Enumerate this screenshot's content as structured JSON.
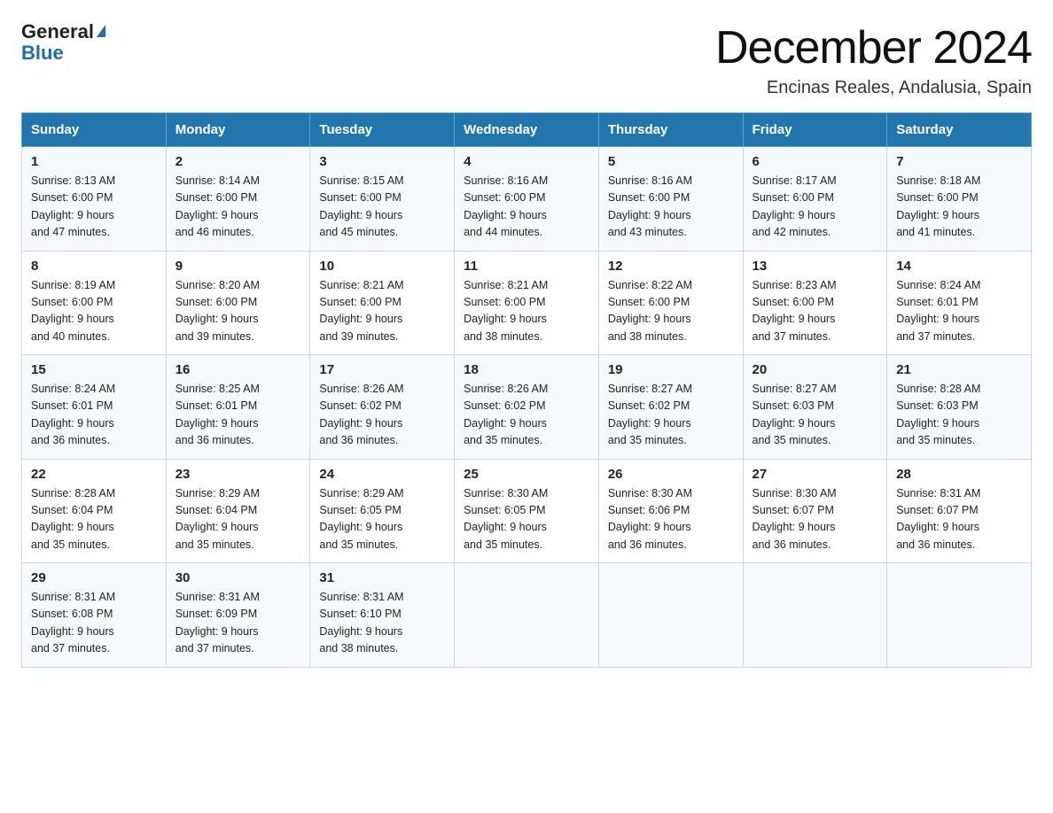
{
  "header": {
    "logo_general": "General",
    "logo_blue": "Blue",
    "main_title": "December 2024",
    "subtitle": "Encinas Reales, Andalusia, Spain"
  },
  "weekdays": [
    "Sunday",
    "Monday",
    "Tuesday",
    "Wednesday",
    "Thursday",
    "Friday",
    "Saturday"
  ],
  "weeks": [
    [
      {
        "day": "1",
        "sunrise": "8:13 AM",
        "sunset": "6:00 PM",
        "daylight": "9 hours and 47 minutes."
      },
      {
        "day": "2",
        "sunrise": "8:14 AM",
        "sunset": "6:00 PM",
        "daylight": "9 hours and 46 minutes."
      },
      {
        "day": "3",
        "sunrise": "8:15 AM",
        "sunset": "6:00 PM",
        "daylight": "9 hours and 45 minutes."
      },
      {
        "day": "4",
        "sunrise": "8:16 AM",
        "sunset": "6:00 PM",
        "daylight": "9 hours and 44 minutes."
      },
      {
        "day": "5",
        "sunrise": "8:16 AM",
        "sunset": "6:00 PM",
        "daylight": "9 hours and 43 minutes."
      },
      {
        "day": "6",
        "sunrise": "8:17 AM",
        "sunset": "6:00 PM",
        "daylight": "9 hours and 42 minutes."
      },
      {
        "day": "7",
        "sunrise": "8:18 AM",
        "sunset": "6:00 PM",
        "daylight": "9 hours and 41 minutes."
      }
    ],
    [
      {
        "day": "8",
        "sunrise": "8:19 AM",
        "sunset": "6:00 PM",
        "daylight": "9 hours and 40 minutes."
      },
      {
        "day": "9",
        "sunrise": "8:20 AM",
        "sunset": "6:00 PM",
        "daylight": "9 hours and 39 minutes."
      },
      {
        "day": "10",
        "sunrise": "8:21 AM",
        "sunset": "6:00 PM",
        "daylight": "9 hours and 39 minutes."
      },
      {
        "day": "11",
        "sunrise": "8:21 AM",
        "sunset": "6:00 PM",
        "daylight": "9 hours and 38 minutes."
      },
      {
        "day": "12",
        "sunrise": "8:22 AM",
        "sunset": "6:00 PM",
        "daylight": "9 hours and 38 minutes."
      },
      {
        "day": "13",
        "sunrise": "8:23 AM",
        "sunset": "6:00 PM",
        "daylight": "9 hours and 37 minutes."
      },
      {
        "day": "14",
        "sunrise": "8:24 AM",
        "sunset": "6:01 PM",
        "daylight": "9 hours and 37 minutes."
      }
    ],
    [
      {
        "day": "15",
        "sunrise": "8:24 AM",
        "sunset": "6:01 PM",
        "daylight": "9 hours and 36 minutes."
      },
      {
        "day": "16",
        "sunrise": "8:25 AM",
        "sunset": "6:01 PM",
        "daylight": "9 hours and 36 minutes."
      },
      {
        "day": "17",
        "sunrise": "8:26 AM",
        "sunset": "6:02 PM",
        "daylight": "9 hours and 36 minutes."
      },
      {
        "day": "18",
        "sunrise": "8:26 AM",
        "sunset": "6:02 PM",
        "daylight": "9 hours and 35 minutes."
      },
      {
        "day": "19",
        "sunrise": "8:27 AM",
        "sunset": "6:02 PM",
        "daylight": "9 hours and 35 minutes."
      },
      {
        "day": "20",
        "sunrise": "8:27 AM",
        "sunset": "6:03 PM",
        "daylight": "9 hours and 35 minutes."
      },
      {
        "day": "21",
        "sunrise": "8:28 AM",
        "sunset": "6:03 PM",
        "daylight": "9 hours and 35 minutes."
      }
    ],
    [
      {
        "day": "22",
        "sunrise": "8:28 AM",
        "sunset": "6:04 PM",
        "daylight": "9 hours and 35 minutes."
      },
      {
        "day": "23",
        "sunrise": "8:29 AM",
        "sunset": "6:04 PM",
        "daylight": "9 hours and 35 minutes."
      },
      {
        "day": "24",
        "sunrise": "8:29 AM",
        "sunset": "6:05 PM",
        "daylight": "9 hours and 35 minutes."
      },
      {
        "day": "25",
        "sunrise": "8:30 AM",
        "sunset": "6:05 PM",
        "daylight": "9 hours and 35 minutes."
      },
      {
        "day": "26",
        "sunrise": "8:30 AM",
        "sunset": "6:06 PM",
        "daylight": "9 hours and 36 minutes."
      },
      {
        "day": "27",
        "sunrise": "8:30 AM",
        "sunset": "6:07 PM",
        "daylight": "9 hours and 36 minutes."
      },
      {
        "day": "28",
        "sunrise": "8:31 AM",
        "sunset": "6:07 PM",
        "daylight": "9 hours and 36 minutes."
      }
    ],
    [
      {
        "day": "29",
        "sunrise": "8:31 AM",
        "sunset": "6:08 PM",
        "daylight": "9 hours and 37 minutes."
      },
      {
        "day": "30",
        "sunrise": "8:31 AM",
        "sunset": "6:09 PM",
        "daylight": "9 hours and 37 minutes."
      },
      {
        "day": "31",
        "sunrise": "8:31 AM",
        "sunset": "6:10 PM",
        "daylight": "9 hours and 38 minutes."
      },
      null,
      null,
      null,
      null
    ]
  ],
  "labels": {
    "sunrise": "Sunrise:",
    "sunset": "Sunset:",
    "daylight": "Daylight:"
  }
}
